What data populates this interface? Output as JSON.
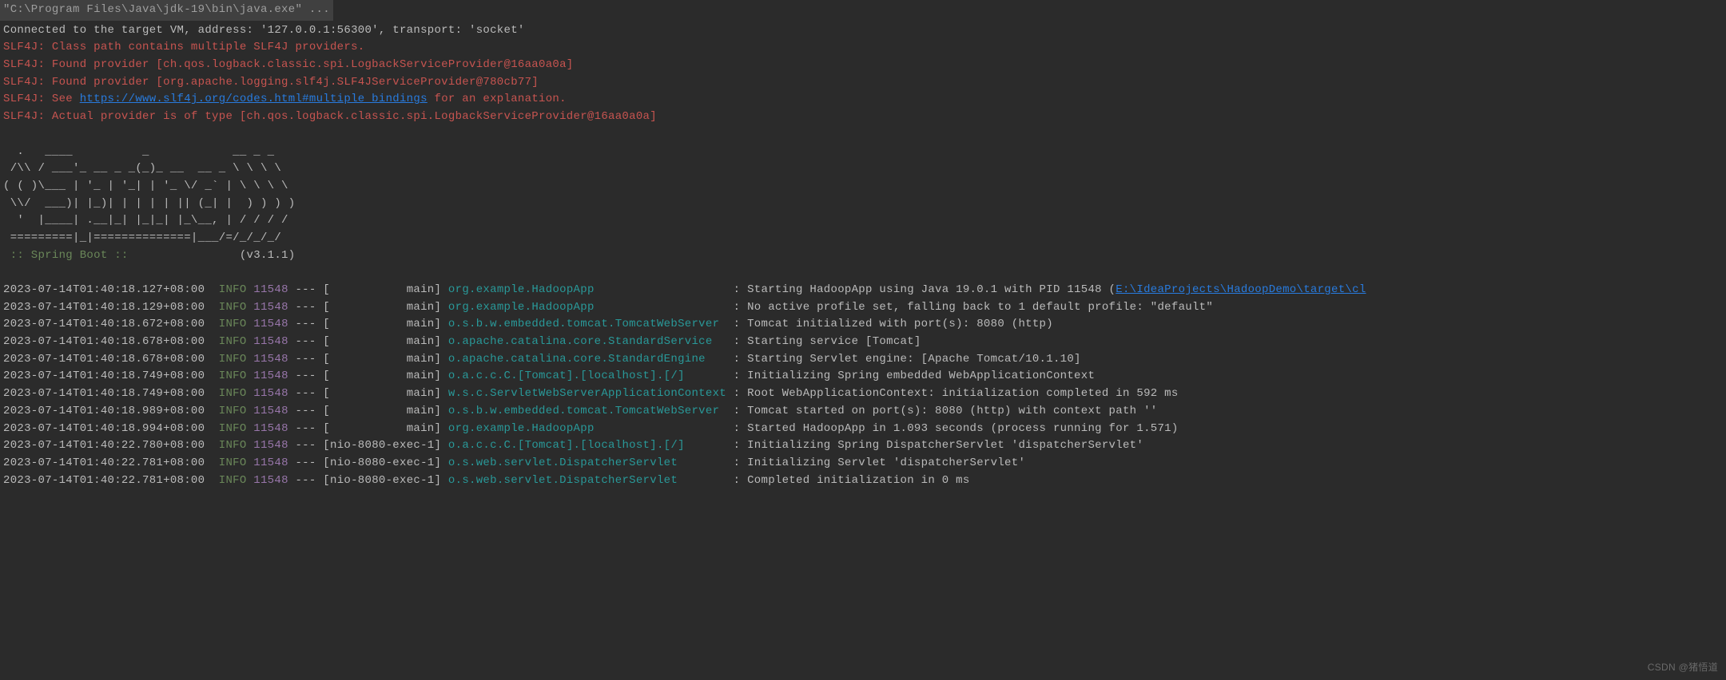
{
  "header": {
    "command": "\"C:\\Program Files\\Java\\jdk-19\\bin\\java.exe\" ..."
  },
  "intro": {
    "connected": "Connected to the target VM, address: '127.0.0.1:56300', transport: 'socket'",
    "slf4j1": "SLF4J: Class path contains multiple SLF4J providers.",
    "slf4j2": "SLF4J: Found provider [ch.qos.logback.classic.spi.LogbackServiceProvider@16aa0a0a]",
    "slf4j3": "SLF4J: Found provider [org.apache.logging.slf4j.SLF4JServiceProvider@780cb77]",
    "slf4j4_prefix": "SLF4J: See ",
    "slf4j4_link": "https://www.slf4j.org/codes.html#multiple_bindings",
    "slf4j4_suffix": " for an explanation.",
    "slf4j5": "SLF4J: Actual provider is of type [ch.qos.logback.classic.spi.LogbackServiceProvider@16aa0a0a]"
  },
  "banner": {
    "l1": "  .   ____          _            __ _ _",
    "l2": " /\\\\ / ___'_ __ _ _(_)_ __  __ _ \\ \\ \\ \\",
    "l3": "( ( )\\___ | '_ | '_| | '_ \\/ _` | \\ \\ \\ \\",
    "l4": " \\\\/  ___)| |_)| | | | | || (_| |  ) ) ) )",
    "l5": "  '  |____| .__|_| |_|_| |_\\__, | / / / /",
    "l6": " =========|_|==============|___/=/_/_/_/",
    "boot_prefix": " :: Spring Boot :: ",
    "boot_version": "               (v3.1.1)"
  },
  "logs": [
    {
      "ts": "2023-07-14T01:40:18.127+08:00",
      "level": "INFO",
      "pid": "11548",
      "sep": " --- [           main] ",
      "logger": "org.example.HadoopApp                   ",
      "msg": " : Starting HadoopApp using Java 19.0.1 with PID 11548 (",
      "link": "E:\\IdeaProjects\\HadoopDemo\\target\\cl"
    },
    {
      "ts": "2023-07-14T01:40:18.129+08:00",
      "level": "INFO",
      "pid": "11548",
      "sep": " --- [           main] ",
      "logger": "org.example.HadoopApp                   ",
      "msg": " : No active profile set, falling back to 1 default profile: \"default\""
    },
    {
      "ts": "2023-07-14T01:40:18.672+08:00",
      "level": "INFO",
      "pid": "11548",
      "sep": " --- [           main] ",
      "logger": "o.s.b.w.embedded.tomcat.TomcatWebServer ",
      "msg": " : Tomcat initialized with port(s): 8080 (http)"
    },
    {
      "ts": "2023-07-14T01:40:18.678+08:00",
      "level": "INFO",
      "pid": "11548",
      "sep": " --- [           main] ",
      "logger": "o.apache.catalina.core.StandardService  ",
      "msg": " : Starting service [Tomcat]"
    },
    {
      "ts": "2023-07-14T01:40:18.678+08:00",
      "level": "INFO",
      "pid": "11548",
      "sep": " --- [           main] ",
      "logger": "o.apache.catalina.core.StandardEngine   ",
      "msg": " : Starting Servlet engine: [Apache Tomcat/10.1.10]"
    },
    {
      "ts": "2023-07-14T01:40:18.749+08:00",
      "level": "INFO",
      "pid": "11548",
      "sep": " --- [           main] ",
      "logger": "o.a.c.c.C.[Tomcat].[localhost].[/]      ",
      "msg": " : Initializing Spring embedded WebApplicationContext"
    },
    {
      "ts": "2023-07-14T01:40:18.749+08:00",
      "level": "INFO",
      "pid": "11548",
      "sep": " --- [           main] ",
      "logger": "w.s.c.ServletWebServerApplicationContext",
      "msg": " : Root WebApplicationContext: initialization completed in 592 ms"
    },
    {
      "ts": "2023-07-14T01:40:18.989+08:00",
      "level": "INFO",
      "pid": "11548",
      "sep": " --- [           main] ",
      "logger": "o.s.b.w.embedded.tomcat.TomcatWebServer ",
      "msg": " : Tomcat started on port(s): 8080 (http) with context path ''"
    },
    {
      "ts": "2023-07-14T01:40:18.994+08:00",
      "level": "INFO",
      "pid": "11548",
      "sep": " --- [           main] ",
      "logger": "org.example.HadoopApp                   ",
      "msg": " : Started HadoopApp in 1.093 seconds (process running for 1.571)"
    },
    {
      "ts": "2023-07-14T01:40:22.780+08:00",
      "level": "INFO",
      "pid": "11548",
      "sep": " --- [nio-8080-exec-1] ",
      "logger": "o.a.c.c.C.[Tomcat].[localhost].[/]      ",
      "msg": " : Initializing Spring DispatcherServlet 'dispatcherServlet'"
    },
    {
      "ts": "2023-07-14T01:40:22.781+08:00",
      "level": "INFO",
      "pid": "11548",
      "sep": " --- [nio-8080-exec-1] ",
      "logger": "o.s.web.servlet.DispatcherServlet       ",
      "msg": " : Initializing Servlet 'dispatcherServlet'"
    },
    {
      "ts": "2023-07-14T01:40:22.781+08:00",
      "level": "INFO",
      "pid": "11548",
      "sep": " --- [nio-8080-exec-1] ",
      "logger": "o.s.web.servlet.DispatcherServlet       ",
      "msg": " : Completed initialization in 0 ms"
    }
  ],
  "watermark": "CSDN @猪悟道"
}
